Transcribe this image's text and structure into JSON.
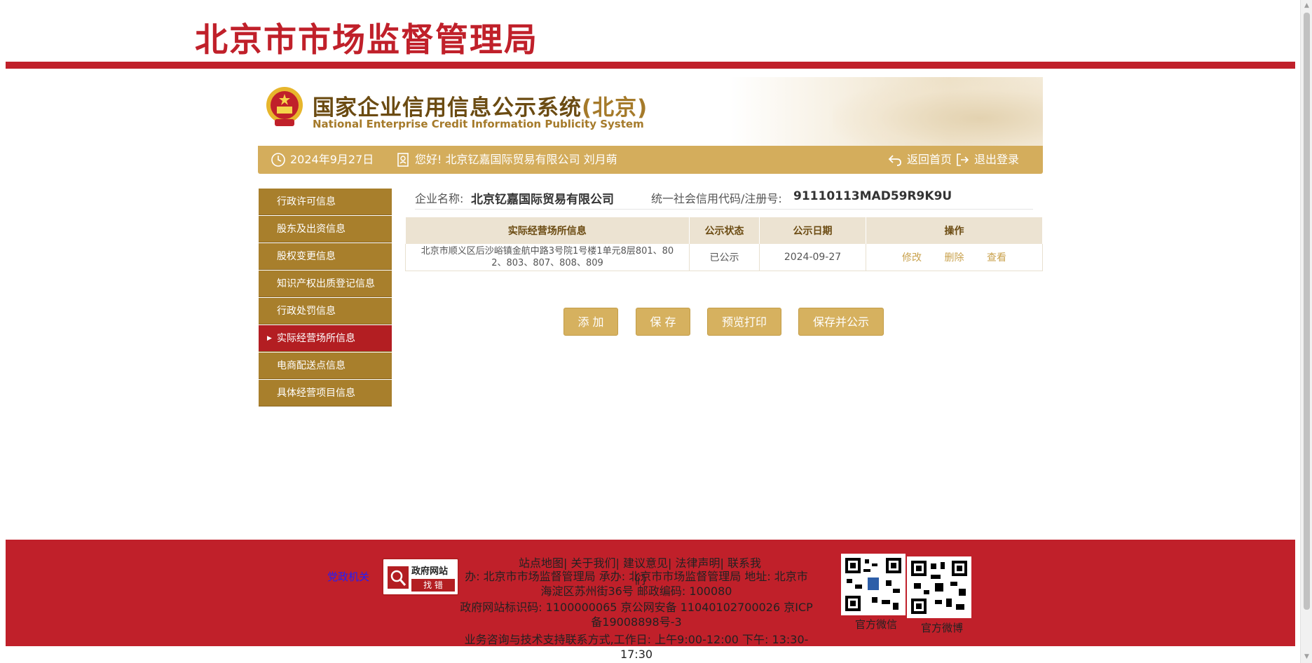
{
  "site": {
    "title": "北京市市场监督管理局"
  },
  "banner": {
    "title_cn": "国家企业信用信息公示系统",
    "title_region": "(北京)",
    "title_en": "National Enterprise Credit Information Publicity System"
  },
  "infobar": {
    "date": "2024年9月27日",
    "greeting": "您好!  北京钇嘉国际贸易有限公司   刘月萌",
    "home_label": "返回首页",
    "logout_label": "退出登录"
  },
  "sidebar": {
    "items": [
      {
        "label": "行政许可信息",
        "active": false
      },
      {
        "label": "股东及出资信息",
        "active": false
      },
      {
        "label": "股权变更信息",
        "active": false
      },
      {
        "label": "知识产权出质登记信息",
        "active": false
      },
      {
        "label": "行政处罚信息",
        "active": false
      },
      {
        "label": "实际经营场所信息",
        "active": true
      },
      {
        "label": "电商配送点信息",
        "active": false
      },
      {
        "label": "具体经营项目信息",
        "active": false
      }
    ]
  },
  "company": {
    "name_label": "企业名称:",
    "name_value": "北京钇嘉国际贸易有限公司",
    "code_label": "统一社会信用代码/注册号:",
    "code_value": "91110113MAD59R9K9U"
  },
  "table": {
    "headers": [
      "实际经营场所信息",
      "公示状态",
      "公示日期",
      "操作"
    ],
    "rows": [
      {
        "address_line1": "北京市顺义区后沙峪镇金航中路3号院1号楼1单元8层801、80",
        "address_line2": "2、803、807、808、809",
        "status": "已公示",
        "date": "2024-09-27",
        "actions": [
          "修改",
          "删除",
          "查看"
        ]
      }
    ]
  },
  "buttons": {
    "add": "添 加",
    "save": "保 存",
    "preview_print": "预览打印",
    "save_publish": "保存并公示"
  },
  "footer": {
    "links": "站点地图| 关于我们| 建议意见| 法律声明| 联系我们",
    "address_line1": "办:  北京市市场监督管理局 承办:  北京市市场监督管理局 地址:  北京市",
    "address_line2": "海淀区苏州街36号 邮政编码:  100080",
    "icp_line1": "政府网站标识码:  1100000065     京公网安备 11040102700026     京ICP",
    "icp_line2": "备19008898号-3",
    "support_line1": "业务咨询与技术支持联系方式,工作日:  上午9:00-12:00 下午:  13:30-",
    "support_line2": "17:30",
    "party_org_alt": "党政机关",
    "jiucuo_top": "政府网站",
    "jiucuo_bottom": "找 错",
    "qr_wechat_label": "官方微信",
    "qr_weibo_label": "官方微博"
  },
  "colors": {
    "brand_red": "#c0202a",
    "gold": "#d4ad5c",
    "sidebar_brown": "#a87f2c",
    "active_red": "#b31e22"
  }
}
